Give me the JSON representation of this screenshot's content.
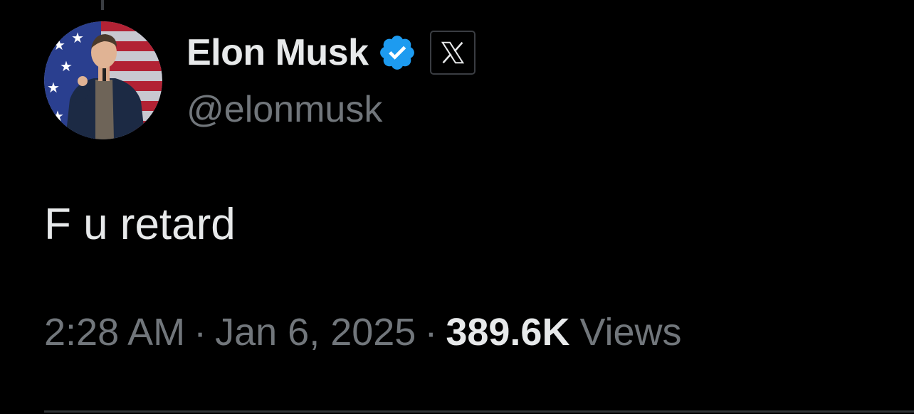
{
  "author": {
    "display_name": "Elon Musk",
    "handle": "@elonmusk",
    "verified_icon": "verified-badge-icon",
    "affiliate_icon": "x-logo-icon",
    "verified_color": "#1d9bf0"
  },
  "tweet": {
    "text": "F u retard",
    "time": "2:28 AM",
    "date": "Jan 6, 2025",
    "separator": "·",
    "views_count": "389.6K",
    "views_label": "Views"
  },
  "colors": {
    "background": "#000000",
    "primary_text": "#e7e9ea",
    "secondary_text": "#71767b",
    "divider": "#2f3336"
  }
}
